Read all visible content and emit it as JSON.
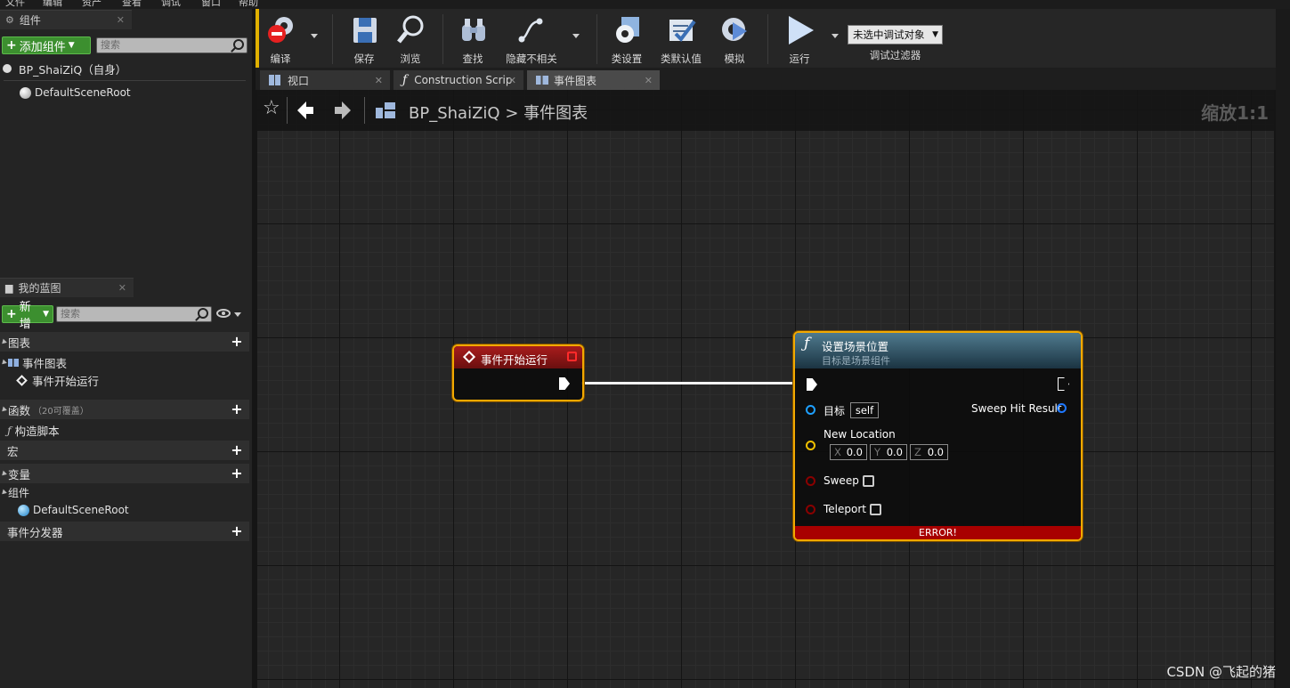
{
  "menu": [
    "文件",
    "编辑",
    "资产",
    "查看",
    "调试",
    "窗口",
    "帮助"
  ],
  "components_panel": {
    "tab_label": "组件",
    "add_button": "添加组件",
    "search_placeholder": "搜索",
    "self_item": "BP_ShaiZiQ（自身）",
    "root_item": "DefaultSceneRoot"
  },
  "my_blueprint": {
    "tab_label": "我的蓝图",
    "new_button": "新增",
    "search_placeholder": "搜索",
    "sections": {
      "graphs": "图表",
      "event_graph": "事件图表",
      "begin_play": "事件开始运行",
      "functions": "函数",
      "functions_note": "（20可覆盖）",
      "construction": "构造脚本",
      "macros": "宏",
      "variables": "变量",
      "components": "组件",
      "component_root": "DefaultSceneRoot",
      "dispatchers": "事件分发器"
    }
  },
  "toolbar": {
    "compile": "编译",
    "save": "保存",
    "browse": "浏览",
    "find": "查找",
    "hide_unrelated": "隐藏不相关",
    "class_settings": "类设置",
    "class_defaults": "类默认值",
    "simulate": "模拟",
    "play": "运行",
    "debug_select": "未选中调试对象",
    "debug_filter": "调试过滤器"
  },
  "doc_tabs": [
    "视口",
    "Construction Scrip",
    "事件图表"
  ],
  "graph": {
    "breadcrumb_bp": "BP_ShaiZiQ",
    "breadcrumb_sep": ">",
    "breadcrumb_graph": "事件图表",
    "zoom": "缩放1:1"
  },
  "event_node": {
    "title": "事件开始运行"
  },
  "func_node": {
    "title": "设置场景位置",
    "subtitle": "目标是场景组件",
    "target_label": "目标",
    "target_value": "self",
    "sweep_hit": "Sweep Hit Result",
    "new_location": "New Location",
    "x_axis": "X",
    "x_value": "0.0",
    "y_axis": "Y",
    "y_value": "0.0",
    "z_axis": "Z",
    "z_value": "0.0",
    "sweep": "Sweep",
    "teleport": "Teleport",
    "error": "ERROR!"
  },
  "watermark": "CSDN @飞起的猪",
  "colors": {
    "accent_green": "#3c8f2f",
    "node_border": "#f2a900",
    "error_red": "#a80000",
    "event_header": "#8a1414"
  }
}
